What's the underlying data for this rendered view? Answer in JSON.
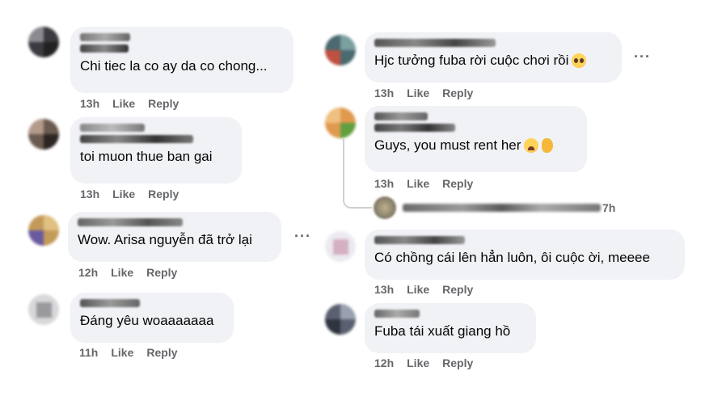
{
  "colors": {
    "bubble_bg": "#f0f2f5",
    "meta_text": "#65676b",
    "body_text": "#050505"
  },
  "actions": {
    "like_label": "Like",
    "reply_label": "Reply"
  },
  "left_column": [
    {
      "text": "Chi tiec la co ay da co chong...",
      "time": "13h"
    },
    {
      "text": "toi muon thue ban gai",
      "time": "13h"
    },
    {
      "text": "Wow. Arisa nguyễn đã trở lại",
      "time": "12h"
    },
    {
      "text": "Đáng yêu woaaaaaaa",
      "time": "11h"
    }
  ],
  "right_column": [
    {
      "text": "Hjc tưởng fuba rời cuộc chơi rồi",
      "time": "13h",
      "emoji": "pleading-face-icon"
    },
    {
      "text": "Guys, you must rent her",
      "time": "13h",
      "emoji": "weary-face-icon"
    },
    {
      "text": "Có chồng cái lên hẳn luôn, ôi cuộc ời, meeee",
      "time": "13h"
    },
    {
      "text": "Fuba tái xuất giang hồ",
      "time": "12h"
    }
  ],
  "collapsed_reply": {
    "time": "7h"
  }
}
